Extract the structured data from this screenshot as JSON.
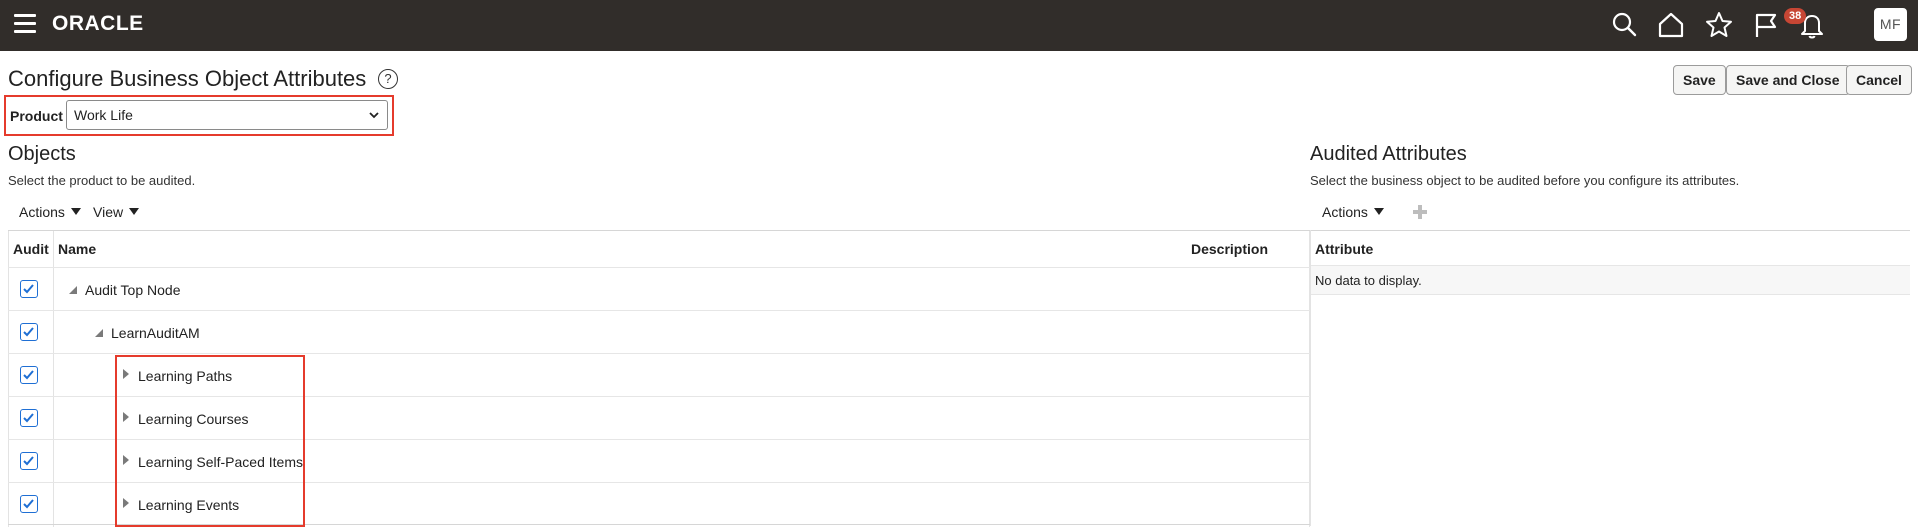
{
  "topbar": {
    "logo": "ORACLE",
    "notification_count": "38",
    "avatar_initials": "MF",
    "icons": [
      "menu-icon",
      "search-icon",
      "home-icon",
      "star-icon",
      "flag-icon",
      "bell-icon"
    ]
  },
  "header": {
    "title": "Configure Business Object Attributes",
    "help_glyph": "?",
    "buttons": {
      "save": "Save",
      "save_close": "Save and Close",
      "cancel": "Cancel"
    }
  },
  "product": {
    "label": "Product",
    "selected": "Work Life"
  },
  "objects": {
    "title": "Objects",
    "description": "Select the product to be audited.",
    "actions_label": "Actions",
    "view_label": "View",
    "columns": {
      "audit": "Audit",
      "name": "Name",
      "description": "Description"
    },
    "rows": [
      {
        "name": "Audit Top Node",
        "checked": true,
        "expanded": true,
        "level": 0
      },
      {
        "name": "LearnAuditAM",
        "checked": true,
        "expanded": true,
        "level": 1
      },
      {
        "name": "Learning Paths",
        "checked": true,
        "expanded": false,
        "level": 2
      },
      {
        "name": "Learning Courses",
        "checked": true,
        "expanded": false,
        "level": 2
      },
      {
        "name": "Learning Self-Paced Items",
        "checked": true,
        "expanded": false,
        "level": 2
      },
      {
        "name": "Learning Events",
        "checked": true,
        "expanded": false,
        "level": 2
      }
    ]
  },
  "audited_attributes": {
    "title": "Audited Attributes",
    "description": "Select the business object to be audited before you configure its attributes.",
    "actions_label": "Actions",
    "column_attribute": "Attribute",
    "empty_text": "No data to display."
  },
  "colors": {
    "topbar": "#312d2a",
    "highlight": "#e53b2c",
    "checkbox": "#1f6fd4",
    "badge": "#c74634"
  }
}
